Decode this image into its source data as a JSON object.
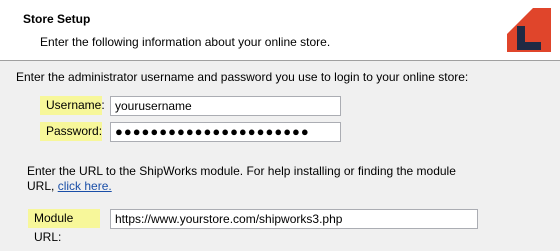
{
  "header": {
    "title": "Store Setup",
    "subtitle": "Enter the following information about your online store."
  },
  "credentials": {
    "instructions": "Enter the administrator username and password you use to login to your online store:",
    "username_label": "Username:",
    "username_value": "yourusername",
    "password_label": "Password:",
    "password_value": "●●●●●●●●●●●●●●●●●●●●●●"
  },
  "module": {
    "instructions_line1": "Enter the URL to the ShipWorks module.  For help installing or finding the module",
    "instructions_line2_prefix": "URL, ",
    "help_link": "click here.",
    "url_label": "Module URL:",
    "url_value": "https://www.yourstore.com/shipworks3.php"
  },
  "colors": {
    "highlight": "#f7f79a",
    "logo_red": "#e0452b",
    "logo_navy": "#1f2a44"
  }
}
